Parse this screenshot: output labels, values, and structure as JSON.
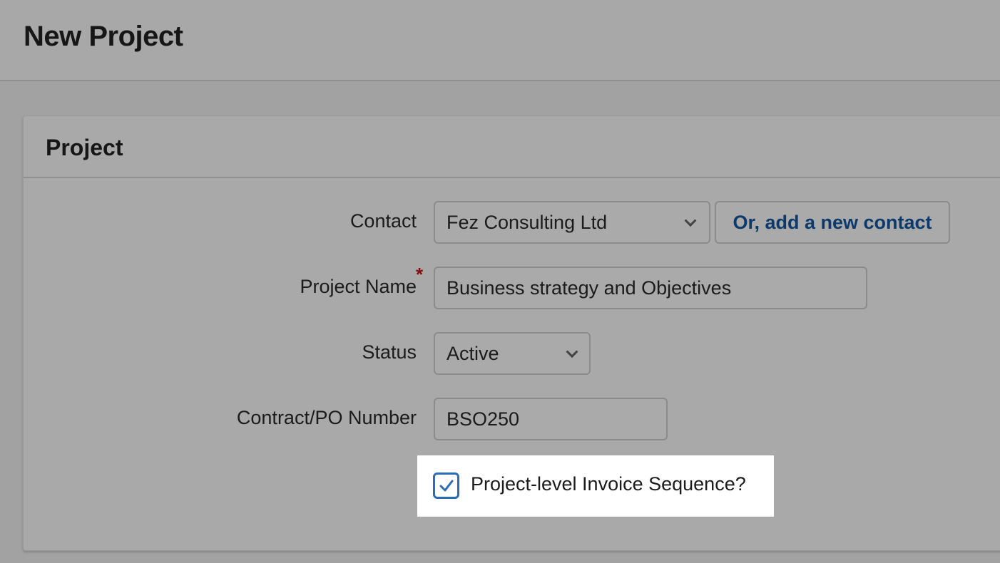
{
  "page": {
    "title": "New Project"
  },
  "card": {
    "title": "Project"
  },
  "form": {
    "contact": {
      "label": "Contact",
      "value": "Fez Consulting Ltd",
      "add_link": "Or, add a new contact"
    },
    "project_name": {
      "label": "Project Name",
      "required_mark": "*",
      "value": "Business strategy and Objectives"
    },
    "status": {
      "label": "Status",
      "value": "Active"
    },
    "contract_po": {
      "label": "Contract/PO Number",
      "value": "BSO250"
    },
    "invoice_sequence": {
      "label": "Project-level Invoice Sequence?",
      "checked": true
    }
  },
  "colors": {
    "checkbox_accent": "#2a6db5",
    "link": "#0d3a6b",
    "required": "#8a0c0c"
  },
  "icons": {
    "dropdown": "chevron-down-icon",
    "checkmark": "checkmark-icon"
  }
}
